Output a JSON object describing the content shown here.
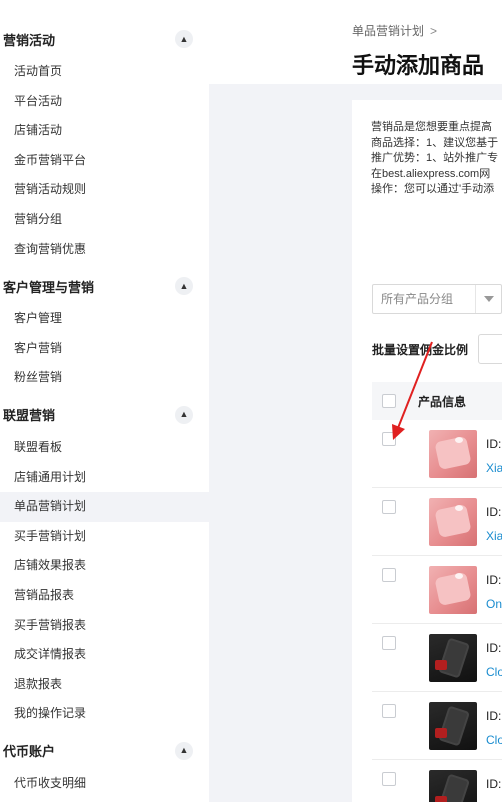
{
  "sidebar": {
    "groups": [
      {
        "title": "营销活动",
        "toggle": "▲",
        "items": [
          {
            "label": "活动首页"
          },
          {
            "label": "平台活动"
          },
          {
            "label": "店铺活动"
          },
          {
            "label": "金币营销平台"
          },
          {
            "label": "营销活动规则"
          },
          {
            "label": "营销分组"
          },
          {
            "label": "查询营销优惠"
          }
        ]
      },
      {
        "title": "客户管理与营销",
        "toggle": "▲",
        "items": [
          {
            "label": "客户管理"
          },
          {
            "label": "客户营销"
          },
          {
            "label": "粉丝营销"
          }
        ]
      },
      {
        "title": "联盟营销",
        "toggle": "▲",
        "items": [
          {
            "label": "联盟看板"
          },
          {
            "label": "店铺通用计划"
          },
          {
            "label": "单品营销计划",
            "active": true
          },
          {
            "label": "买手营销计划"
          },
          {
            "label": "店铺效果报表"
          },
          {
            "label": "营销品报表"
          },
          {
            "label": "买手营销报表"
          },
          {
            "label": "成交详情报表"
          },
          {
            "label": "退款报表"
          },
          {
            "label": "我的操作记录"
          }
        ]
      },
      {
        "title": "代币账户",
        "toggle": "▲",
        "items": [
          {
            "label": "代币收支明细"
          }
        ]
      }
    ]
  },
  "header": {
    "breadcrumb": "单品营销计划",
    "breadcrumb_separator": ">",
    "title": "手动添加商品"
  },
  "info": {
    "lines": [
      "营销品是您想要重点提高",
      "商品选择：1、建议您基于",
      "推广优势：1、站外推广专",
      "在best.aliexpress.com网",
      "操作：您可以通过'手动添"
    ]
  },
  "filters": {
    "group_select": "所有产品分组",
    "batch_label": "批量设置佣金比例"
  },
  "table": {
    "header_label": "产品信息",
    "rows": [
      {
        "id_label": "ID:",
        "title": "Xia",
        "thumb": "pink"
      },
      {
        "id_label": "ID:",
        "title": "Xia",
        "thumb": "pink"
      },
      {
        "id_label": "ID:",
        "title": "On",
        "thumb": "pink"
      },
      {
        "id_label": "ID:",
        "title": "Clo",
        "thumb": "dark"
      },
      {
        "id_label": "ID:",
        "title": "Clo",
        "thumb": "dark"
      },
      {
        "id_label": "ID:",
        "title": "",
        "thumb": "dark"
      }
    ]
  },
  "colors": {
    "annotation_arrow": "#e02020",
    "link": "#1a8ccf"
  }
}
